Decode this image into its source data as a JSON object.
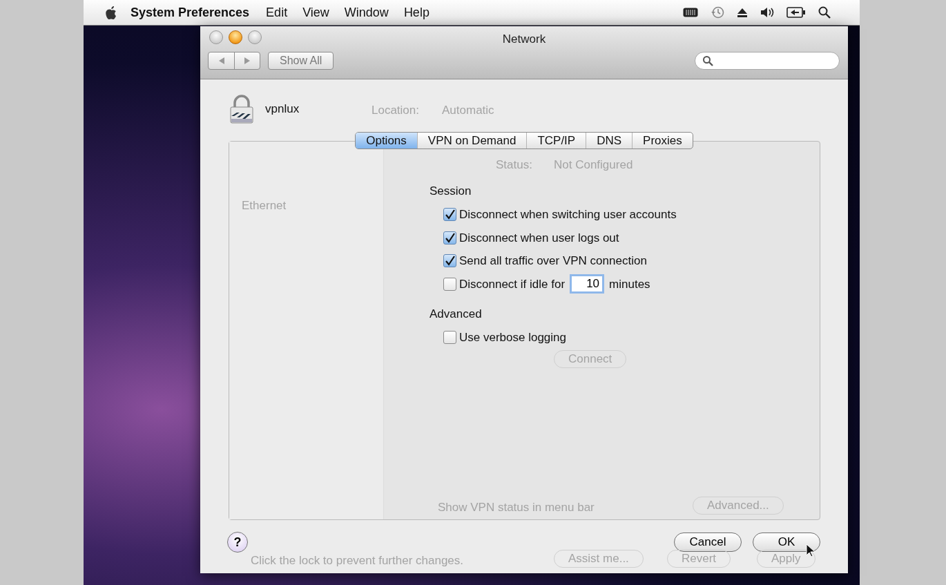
{
  "menu_bar": {
    "app_name": "System Preferences",
    "menus": [
      "Edit",
      "View",
      "Window",
      "Help"
    ]
  },
  "window": {
    "title": "Network",
    "show_all": "Show All"
  },
  "background": {
    "location_label": "Location:",
    "location_value": "Automatic",
    "service": "Ethernet",
    "status_label": "Status:",
    "status_value": "Not Configured",
    "connect": "Connect",
    "show_status": "Show VPN status in menu bar",
    "advanced": "Advanced...",
    "lock_message": "Click the lock to prevent further changes.",
    "buttons": [
      "Assist me...",
      "Revert",
      "Apply"
    ]
  },
  "sheet": {
    "service_name": "vpnlux",
    "tabs": [
      {
        "label": "Options",
        "selected": true
      },
      {
        "label": "VPN on Demand",
        "selected": false
      },
      {
        "label": "TCP/IP",
        "selected": false
      },
      {
        "label": "DNS",
        "selected": false
      },
      {
        "label": "Proxies",
        "selected": false
      }
    ],
    "sections": [
      {
        "heading": "Session",
        "options": [
          {
            "kind": "checkbox",
            "label": "Disconnect when switching user accounts",
            "checked": true
          },
          {
            "kind": "checkbox",
            "label": "Disconnect when user logs out",
            "checked": true
          },
          {
            "kind": "checkbox",
            "label": "Send all traffic over VPN connection",
            "checked": true
          },
          {
            "kind": "timeout",
            "label": "Disconnect if idle for",
            "value": "10",
            "suffix": "minutes",
            "checked": false
          }
        ]
      },
      {
        "heading": "Advanced",
        "options": [
          {
            "kind": "checkbox",
            "label": "Use verbose logging",
            "checked": false
          }
        ]
      }
    ],
    "help": "?",
    "buttons": [
      "Cancel",
      "OK"
    ]
  }
}
